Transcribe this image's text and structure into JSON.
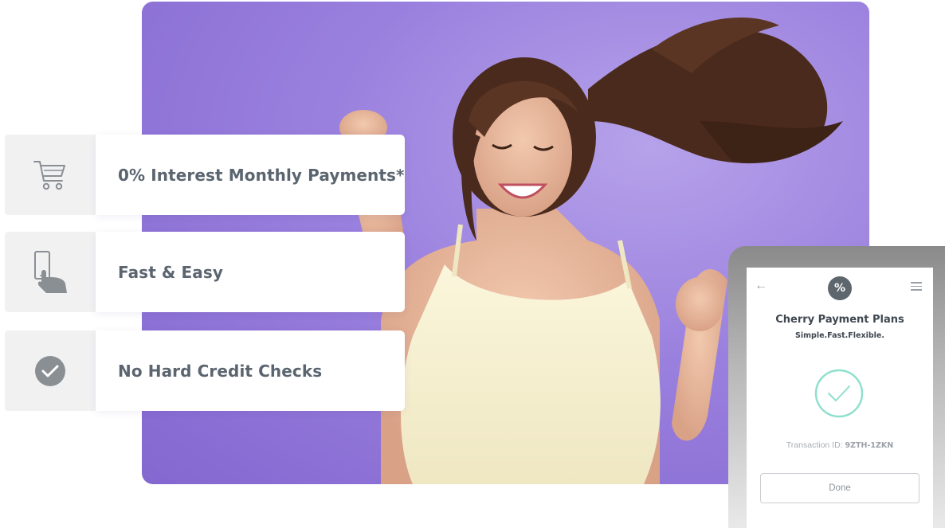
{
  "features": [
    {
      "icon": "shopping-cart-icon",
      "label": "0% Interest Monthly Payments*"
    },
    {
      "icon": "phone-tap-icon",
      "label": "Fast & Easy"
    },
    {
      "icon": "check-circle-icon",
      "label": "No Hard Credit Checks"
    }
  ],
  "phone": {
    "back_icon": "arrow-left-icon",
    "menu_icon": "hamburger-menu-icon",
    "logo_text": "%",
    "title": "Cherry Payment Plans",
    "subtitle": "Simple.Fast.Flexible.",
    "success_icon": "check-circle-outline-icon",
    "transaction_label": "Transaction ID:",
    "transaction_id": "9ZTH-1ZKN",
    "done_label": "Done"
  },
  "colors": {
    "hero_purple": "#9a80de",
    "text_gray": "#5b6570",
    "success_teal": "#8fe0cc",
    "icon_gray": "#8a8f94"
  }
}
